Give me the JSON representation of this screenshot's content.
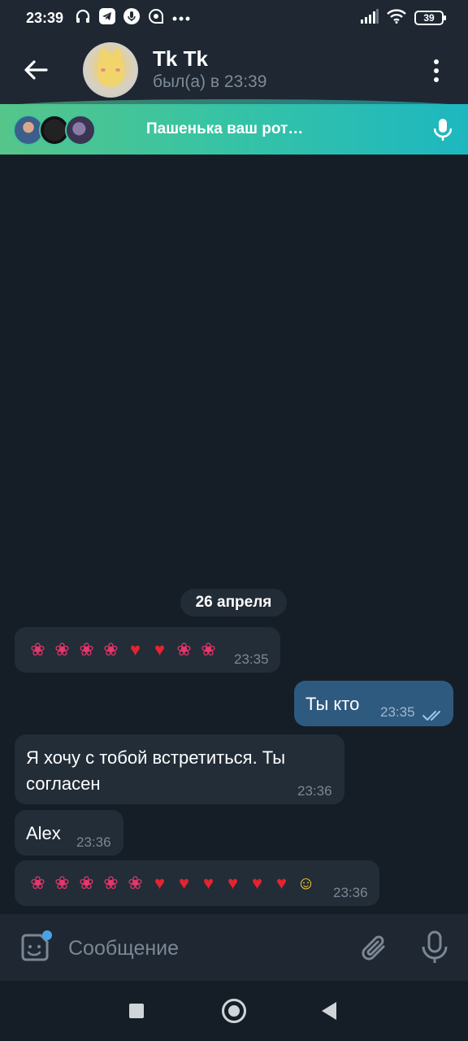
{
  "status_bar": {
    "time": "23:39",
    "battery": "39",
    "icons_left": [
      "headphones-icon",
      "telegram-icon",
      "mic-icon",
      "chat-bubble-icon",
      "more-dots-icon"
    ],
    "icons_right": [
      "signal-icon",
      "wifi-icon",
      "battery-icon"
    ]
  },
  "header": {
    "contact_name": "Tk Tk",
    "last_seen": "был(а) в 23:39"
  },
  "voice_chat": {
    "title": "Пашенька ваш рот…"
  },
  "chat": {
    "date_separator": "26 апреля",
    "messages": [
      {
        "direction": "in",
        "emoji": [
          "hibiscus",
          "hibiscus",
          "hibiscus",
          "hibiscus",
          "red-heart",
          "red-heart",
          "hibiscus",
          "hibiscus"
        ],
        "time": "23:35"
      },
      {
        "direction": "out",
        "text": "Ты кто",
        "time": "23:35",
        "read": true
      },
      {
        "direction": "in",
        "text_line1": "Я хочу с тобой встретиться. Ты",
        "text_line2": "согласен",
        "time": "23:36"
      },
      {
        "direction": "in",
        "text": "Alex",
        "time": "23:36"
      },
      {
        "direction": "in",
        "emoji": [
          "hibiscus",
          "hibiscus",
          "hibiscus",
          "hibiscus",
          "hibiscus",
          "red-heart",
          "red-heart",
          "red-heart",
          "red-heart",
          "red-heart",
          "red-heart",
          "heart-eyes-face"
        ],
        "time": "23:36"
      }
    ]
  },
  "input": {
    "placeholder": "Сообщение"
  },
  "colors": {
    "background": "#151e27",
    "bar": "#1e2732",
    "incoming_bubble": "#222d38",
    "outgoing_bubble": "#2f5a7f",
    "banner_start": "#56c58a",
    "banner_end": "#1db7c0",
    "accent": "#4aa3ea"
  }
}
